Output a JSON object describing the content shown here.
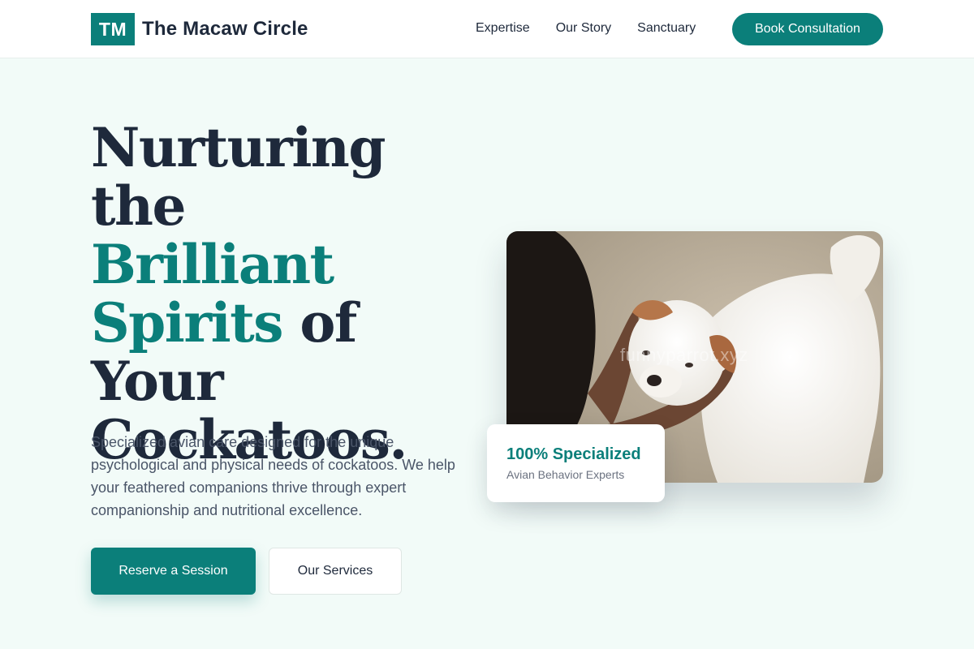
{
  "header": {
    "logo_initials": "TM",
    "brand_name": "The Macaw Circle",
    "nav": [
      {
        "label": "Expertise"
      },
      {
        "label": "Our Story"
      },
      {
        "label": "Sanctuary"
      }
    ],
    "cta_label": "Book Consultation"
  },
  "hero": {
    "headline": {
      "line1": "Nurturing the",
      "accent": "Brilliant Spirits",
      "after_accent": " of",
      "line3": "Your",
      "line4": "Cockatoos."
    },
    "description": "Specialized avian care designed for the unique psychological and physical needs of cockatoos. We help your feathered companions thrive through expert companionship and nutritional excellence.",
    "primary_button": "Reserve a Session",
    "secondary_button": "Our Services"
  },
  "photo": {
    "watermark": "funnyparrot.xyz"
  },
  "stat": {
    "title": "100% Specialized",
    "subtitle": "Avian Behavior Experts"
  },
  "colors": {
    "accent": "#0b7f7a",
    "text_dark": "#1e293b",
    "background": "#f2fbf8"
  }
}
